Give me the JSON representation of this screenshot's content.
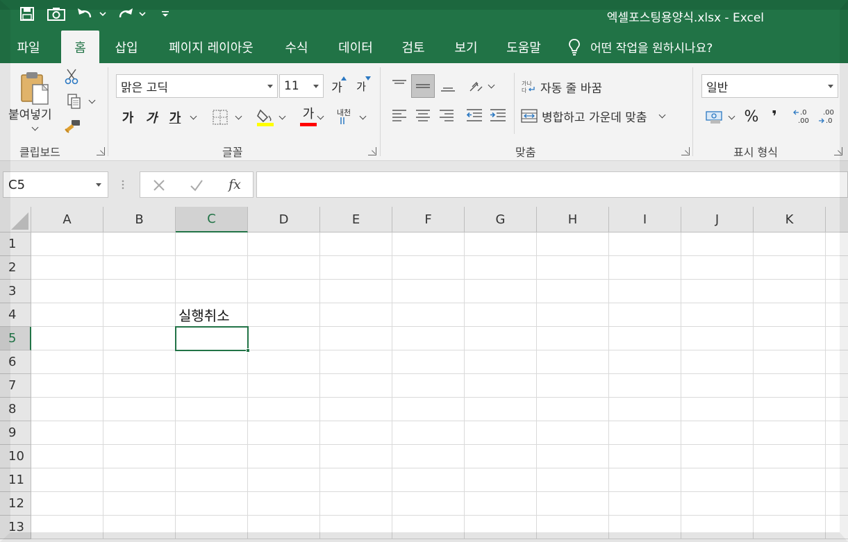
{
  "window": {
    "doc_title": "엑셀포스팅용양식.xlsx  -  Excel"
  },
  "quick_access": [
    "save-icon",
    "camera-icon",
    "undo-icon",
    "redo-icon",
    "customize-qat-icon"
  ],
  "tabs": [
    {
      "label": "파일"
    },
    {
      "label": "홈"
    },
    {
      "label": "삽입"
    },
    {
      "label": "페이지 레이아웃"
    },
    {
      "label": "수식"
    },
    {
      "label": "데이터"
    },
    {
      "label": "검토"
    },
    {
      "label": "보기"
    },
    {
      "label": "도움말"
    }
  ],
  "active_tab": "홈",
  "tell_me": "어떤 작업을 원하시나요?",
  "ribbon": {
    "clipboard": {
      "paste_label": "붙여넣기",
      "group_label": "클립보드"
    },
    "font": {
      "font_name": "맑은 고딕",
      "font_size": "11",
      "grow_label": "가",
      "shrink_label": "가",
      "bold_label": "가",
      "italic_label": "가",
      "underline_label": "가",
      "font_color_label": "가",
      "phonetic_label": "내천",
      "group_label": "글꼴",
      "fill_color": "#ffff00",
      "font_color": "#ff0000"
    },
    "alignment": {
      "wrap_label": "자동 줄 바꿈",
      "merge_label": "병합하고 가운데 맞춤",
      "group_label": "맞춤"
    },
    "number": {
      "format": "일반",
      "percent_label": "%",
      "comma_label": "❜",
      "inc_decimal": ".0 .00",
      "dec_decimal": ".00 .0",
      "group_label": "표시 형식"
    }
  },
  "formula_bar": {
    "name_box": "C5",
    "formula": ""
  },
  "sheet": {
    "columns": [
      "A",
      "B",
      "C",
      "D",
      "E",
      "F",
      "G",
      "H",
      "I",
      "J",
      "K"
    ],
    "rows": [
      "1",
      "2",
      "3",
      "4",
      "5",
      "6",
      "7",
      "8",
      "9",
      "10",
      "11",
      "12",
      "13"
    ],
    "selected_column": "C",
    "selected_row": "5",
    "cells": {
      "C4": "실행취소"
    }
  },
  "colors": {
    "accent": "#217346"
  }
}
